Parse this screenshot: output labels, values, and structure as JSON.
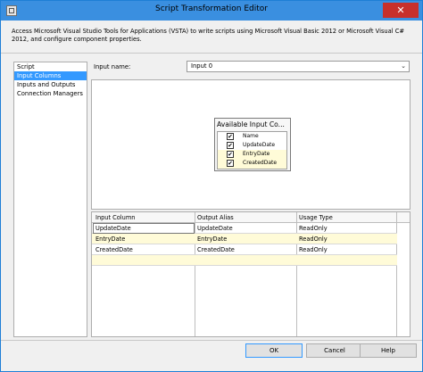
{
  "window": {
    "title": "Script Transformation Editor",
    "close_glyph": "✕"
  },
  "description": "Access Microsoft Visual Studio Tools for Applications (VSTA) to write scripts using Microsoft Visual Basic 2012 or Microsoft Visual C# 2012, and configure component properties.",
  "nav": {
    "items": [
      {
        "label": "Script",
        "selected": false
      },
      {
        "label": "Input Columns",
        "selected": true
      },
      {
        "label": "Inputs and Outputs",
        "selected": false
      },
      {
        "label": "Connection Managers",
        "selected": false
      }
    ]
  },
  "input": {
    "label": "Input name:",
    "value": "Input 0",
    "chevron": "⌄"
  },
  "available_columns": {
    "title": "Available Input Co...",
    "check_glyph": "✔",
    "items": [
      {
        "name": "Name",
        "checked": true
      },
      {
        "name": "UpdateDate",
        "checked": true
      },
      {
        "name": "EntryDate",
        "checked": true
      },
      {
        "name": "CreatedDate",
        "checked": true
      }
    ]
  },
  "grid": {
    "headers": [
      "Input Column",
      "Output Alias",
      "Usage Type"
    ],
    "rows": [
      [
        "UpdateDate",
        "UpdateDate",
        "ReadOnly"
      ],
      [
        "EntryDate",
        "EntryDate",
        "ReadOnly"
      ],
      [
        "CreatedDate",
        "CreatedDate",
        "ReadOnly"
      ]
    ]
  },
  "buttons": {
    "ok": "OK",
    "cancel": "Cancel",
    "help": "Help"
  },
  "colors": {
    "titlebar": "#3a8fe0",
    "selection": "#3399ff",
    "close": "#c7302b",
    "row_highlight": "#fffbd8"
  }
}
